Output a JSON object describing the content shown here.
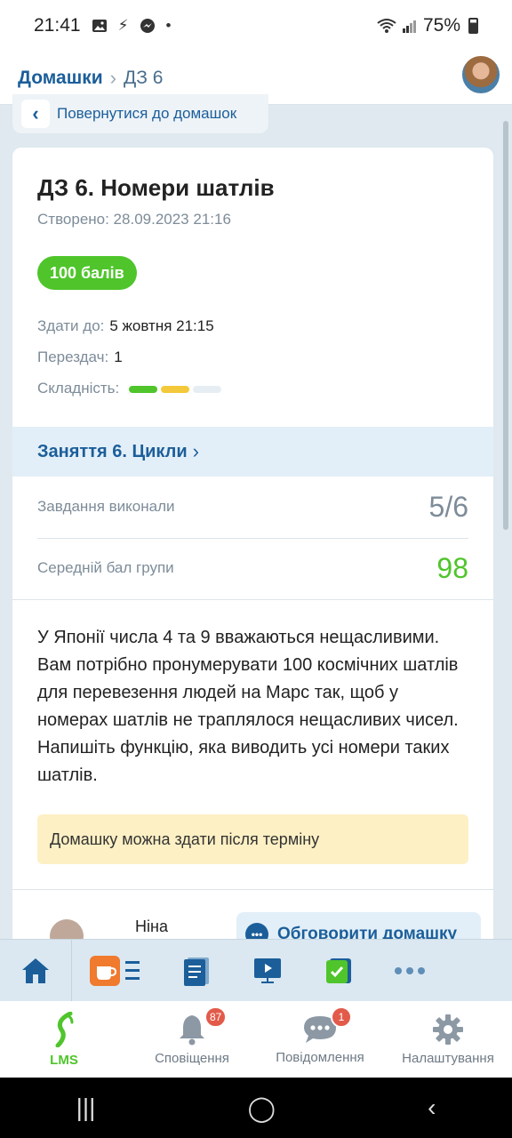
{
  "status_bar": {
    "time": "21:41",
    "battery": "75%"
  },
  "header": {
    "breadcrumb_link": "Домашки",
    "breadcrumb_current": "ДЗ 6"
  },
  "back_button": {
    "label": "Повернутися до домашок"
  },
  "homework": {
    "title": "ДЗ 6. Номери шатлів",
    "created": "Створено: 28.09.2023 21:16",
    "score_badge": "100 балів",
    "deadline_label": "Здати до:",
    "deadline_value": "5 жовтня 21:15",
    "resubmits_label": "Перездач:",
    "resubmits_value": "1",
    "difficulty_label": "Складність:",
    "difficulty_level": 2,
    "difficulty_colors": [
      "#4fc52b",
      "#f3c93b",
      "#e7eef3"
    ]
  },
  "lesson": {
    "label": "Заняття 6. Цикли"
  },
  "stats": {
    "completed_label": "Завдання виконали",
    "completed_value": "5/6",
    "completed_color": "#7d8c99",
    "avg_label": "Середній бал групи",
    "avg_value": "98",
    "avg_color": "#4fc52b"
  },
  "description": "У Японії числа 4 та 9 вважаються нещасливими. Вам потрібно пронумерувати 100 космічних шатлів для перевезення людей на Марс так, щоб у номерах шатлів не траплялося нещасливих чисел. Напишіть функцію, яка виводить усі номери таких шатлів.",
  "notice": "Домашку можна здати після терміну",
  "author": {
    "name": "Ніна"
  },
  "discuss_button": {
    "label": "Обговорити домашку"
  },
  "bottom_nav": {
    "lms": "LMS",
    "notifications": "Сповіщення",
    "notifications_badge": "87",
    "messages": "Повідомлення",
    "messages_badge": "1",
    "settings": "Налаштування"
  }
}
